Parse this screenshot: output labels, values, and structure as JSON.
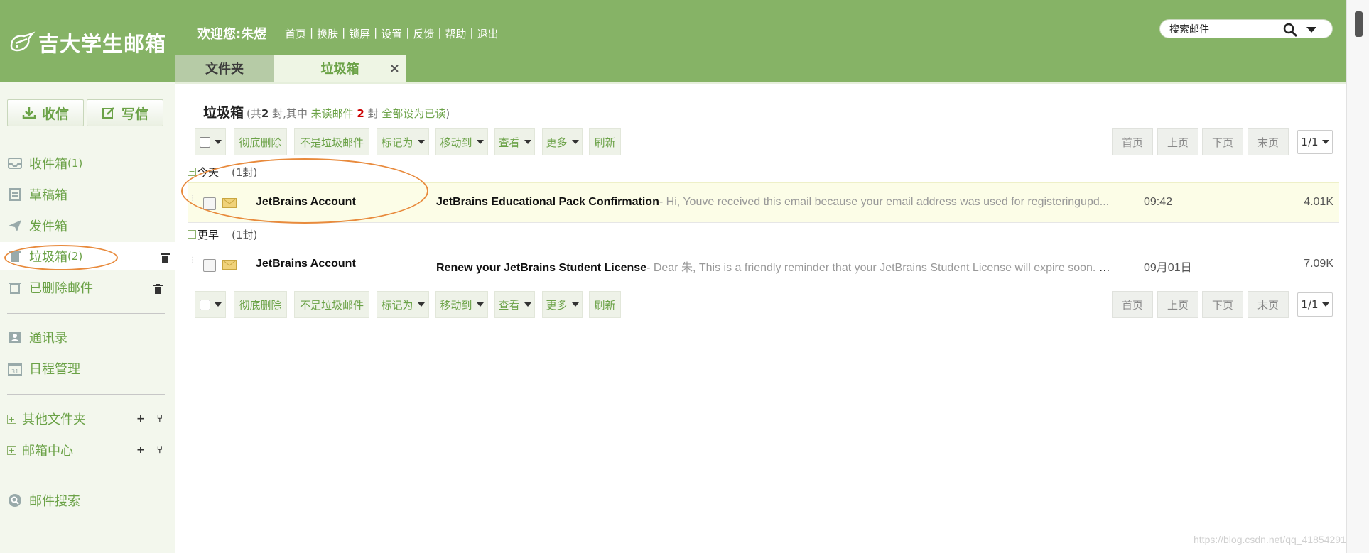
{
  "header": {
    "logo_text": "吉大学生邮箱",
    "welcome": "欢迎您:朱煜",
    "nav": [
      "首页",
      "换肤",
      "锁屏",
      "设置",
      "反馈",
      "帮助",
      "退出"
    ],
    "search_placeholder": "搜索邮件"
  },
  "tabs": {
    "folders_label": "文件夹",
    "trash_label": "垃圾箱",
    "close_glyph": "×"
  },
  "sidebar": {
    "receive_label": "收信",
    "write_label": "写信",
    "folders": [
      {
        "label": "收件箱",
        "count": "(1)",
        "icon": "inbox-icon"
      },
      {
        "label": "草稿箱",
        "count": "",
        "icon": "draft-icon"
      },
      {
        "label": "发件箱",
        "count": "",
        "icon": "send-icon"
      },
      {
        "label": "垃圾箱",
        "count": "(2)",
        "icon": "junk-icon"
      },
      {
        "label": "已删除邮件",
        "count": "",
        "icon": "trash-icon"
      }
    ],
    "tools": [
      {
        "label": "通讯录",
        "icon": "contacts-icon"
      },
      {
        "label": "日程管理",
        "icon": "calendar-icon"
      }
    ],
    "groups": [
      {
        "label": "其他文件夹"
      },
      {
        "label": "邮箱中心"
      }
    ],
    "search_label": "邮件搜索"
  },
  "main": {
    "folder_name": "垃圾箱",
    "info_prefix": "(共",
    "info_total": "2",
    "info_mid": " 封,其中 ",
    "info_unread_label": "未读邮件",
    "info_unread": "2",
    "info_suffix": " 封 ",
    "info_markall": "全部设为已读",
    "info_close": ")",
    "toolbar": {
      "delete_label": "彻底删除",
      "notspam_label": "不是垃圾邮件",
      "markas_label": "标记为",
      "moveto_label": "移动到",
      "view_label": "查看",
      "more_label": "更多",
      "refresh_label": "刷新"
    },
    "pager": {
      "first": "首页",
      "prev": "上页",
      "next": "下页",
      "last": "末页",
      "page": "1/1"
    },
    "groups": [
      {
        "label": "今天",
        "count": "(1封)",
        "mails": [
          {
            "sender": "JetBrains Account",
            "subject": "JetBrains Educational Pack Confirmation",
            "preview": "- Hi, Youve received this email because your email address was used for registeringupd...",
            "time": "09:42",
            "size": "4.01K"
          }
        ]
      },
      {
        "label": "更早",
        "count": "(1封)",
        "mails": [
          {
            "sender": "JetBrains Account",
            "subject": "Renew your JetBrains Student License",
            "preview": "- Dear 朱, This is a friendly reminder that your JetBrains Student License will expire soon. Pl...",
            "time": "09月01日",
            "size": "7.09K"
          }
        ]
      }
    ]
  },
  "watermark": "https://blog.csdn.net/qq_41854291",
  "colors": {
    "header_green": "#86b366",
    "accent_green": "#6ba247",
    "annotation_orange": "#e88a3c"
  }
}
